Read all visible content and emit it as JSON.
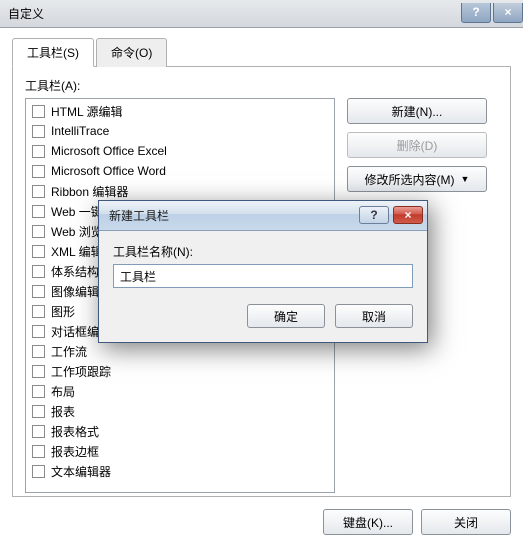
{
  "window": {
    "title": "自定义",
    "help_symbol": "?",
    "close_symbol": "×"
  },
  "tabs": [
    {
      "label": "工具栏(S)",
      "active": true
    },
    {
      "label": "命令(O)",
      "active": false
    }
  ],
  "list_label": "工具栏(A):",
  "toolbars": [
    "HTML 源编辑",
    "IntelliTrace",
    "Microsoft Office Excel",
    "Microsoft Office Word",
    "Ribbon 编辑器",
    "Web 一键式发布",
    "Web 浏览器",
    "XML 编辑器",
    "体系结构资源管理器",
    "图像编辑器",
    "图形",
    "对话框编辑器",
    "工作流",
    "工作项跟踪",
    "布局",
    "报表",
    "报表格式",
    "报表边框",
    "文本编辑器"
  ],
  "side_buttons": {
    "new": "新建(N)...",
    "delete": "删除(D)",
    "modify": "修改所选内容(M)"
  },
  "footer_buttons": {
    "keyboard": "键盘(K)...",
    "close": "关闭"
  },
  "modal": {
    "title": "新建工具栏",
    "help_symbol": "?",
    "close_symbol": "×",
    "field_label": "工具栏名称(N):",
    "field_value": "工具栏",
    "ok": "确定",
    "cancel": "取消"
  }
}
